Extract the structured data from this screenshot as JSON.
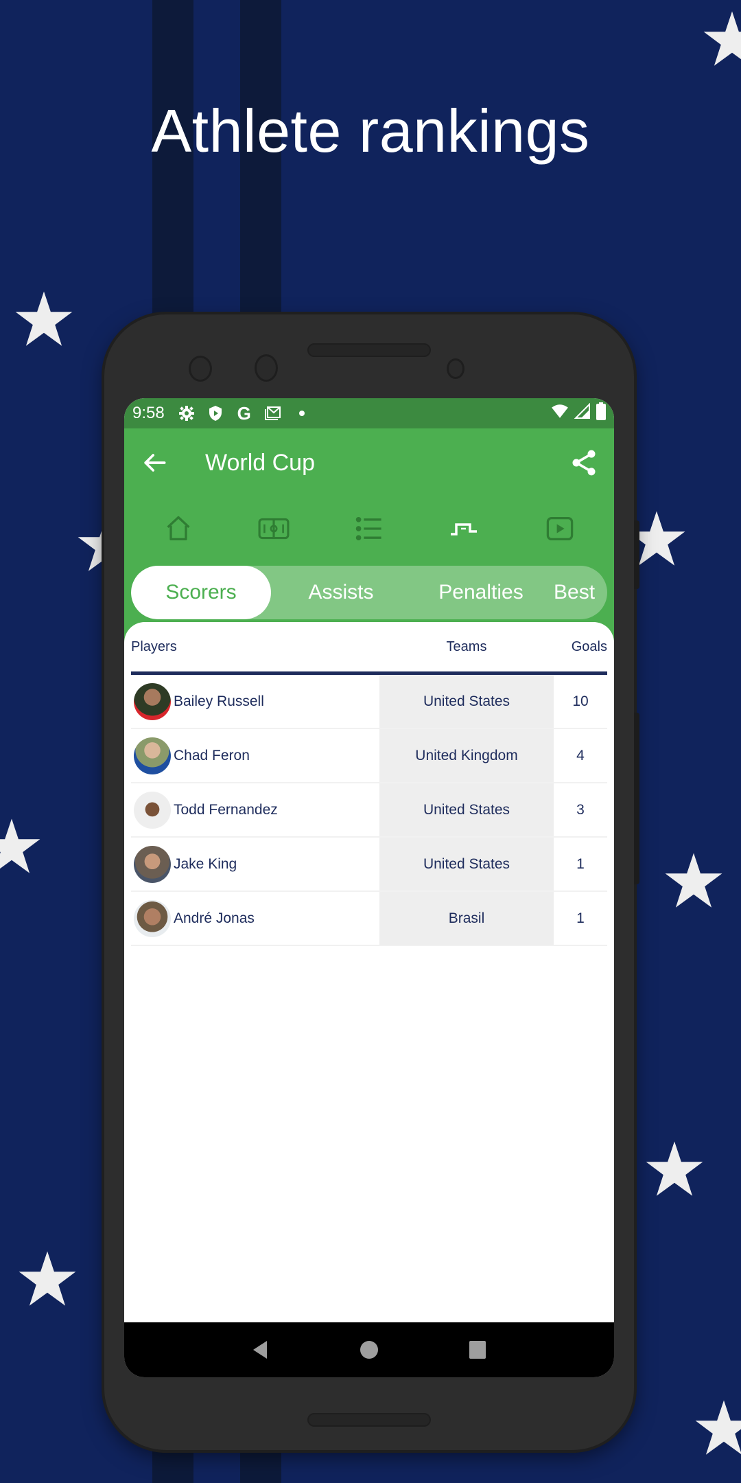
{
  "headline": "Athlete rankings",
  "colors": {
    "background": "#10235c",
    "stripe": "#0d1a3a",
    "brand_green": "#4caf50",
    "status_green": "#3c8a40",
    "text_navy": "#1e2c5c",
    "team_cell_bg": "#eeeeee"
  },
  "statusbar": {
    "time": "9:58",
    "left_icons": [
      "settings-icon",
      "shield-play-icon",
      "google-icon",
      "gmail-icon",
      "dot-icon"
    ],
    "right_icons": [
      "wifi-icon",
      "signal-icon",
      "battery-icon"
    ]
  },
  "appbar": {
    "title": "World Cup",
    "back_icon": "arrow-left-icon",
    "share_icon": "share-icon"
  },
  "section_icons": [
    {
      "name": "home-icon",
      "active": false
    },
    {
      "name": "field-icon",
      "active": false
    },
    {
      "name": "list-icon",
      "active": false
    },
    {
      "name": "podium-icon",
      "active": true
    },
    {
      "name": "video-icon",
      "active": false
    }
  ],
  "tabs": [
    {
      "label": "Scorers",
      "active": true
    },
    {
      "label": "Assists",
      "active": false
    },
    {
      "label": "Penalties",
      "active": false
    },
    {
      "label": "Best",
      "active": false
    }
  ],
  "table": {
    "headers": {
      "players": "Players",
      "teams": "Teams",
      "goals": "Goals"
    },
    "rows": [
      {
        "player": "Bailey Russell",
        "team": "United States",
        "goals": "10"
      },
      {
        "player": "Chad Feron",
        "team": "United Kingdom",
        "goals": "4"
      },
      {
        "player": "Todd Fernandez",
        "team": "United States",
        "goals": "3"
      },
      {
        "player": "Jake King",
        "team": "United States",
        "goals": "1"
      },
      {
        "player": "André Jonas",
        "team": "Brasil",
        "goals": "1"
      }
    ]
  },
  "navbar": [
    "back-icon",
    "home-icon",
    "recents-icon"
  ]
}
